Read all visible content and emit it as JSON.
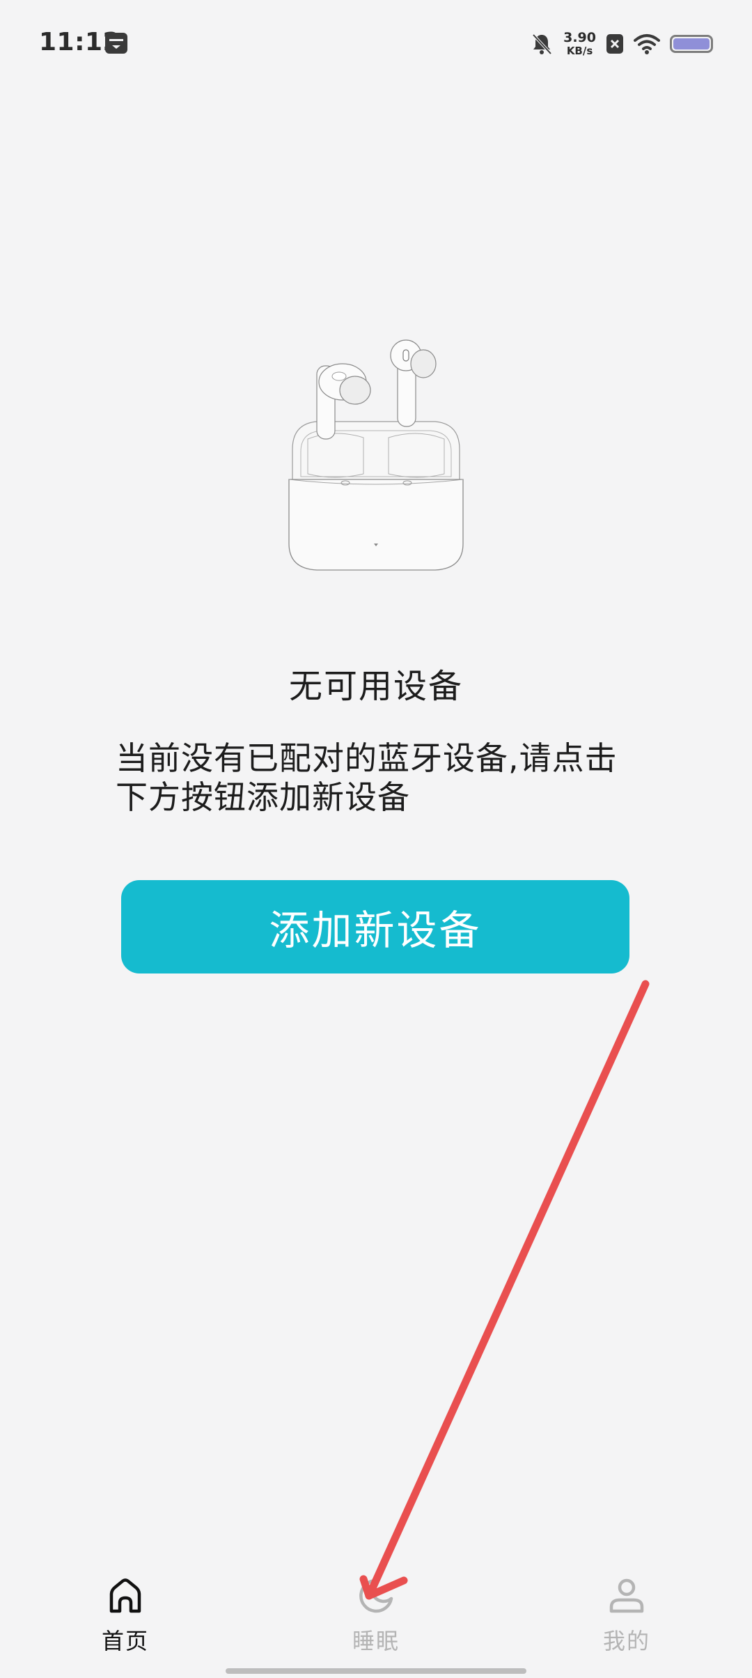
{
  "status_bar": {
    "time": "11:12",
    "network_speed_value": "3.90",
    "network_speed_unit": "KB/s",
    "battery_level": 1.0,
    "icons": [
      "calendar-icon",
      "bell-muted-icon",
      "no-sim-icon",
      "wifi-icon",
      "battery-icon"
    ]
  },
  "main": {
    "empty_title": "无可用设备",
    "empty_description": "当前没有已配对的蓝牙设备,请点击下方按钮添加新设备",
    "add_button_label": "添加新设备",
    "image_icon": "earbuds-case-illustration"
  },
  "bottom_nav": {
    "items": [
      {
        "label": "首页",
        "icon": "home-icon",
        "active": true
      },
      {
        "label": "睡眠",
        "icon": "moon-icon",
        "active": false
      },
      {
        "label": "我的",
        "icon": "person-icon",
        "active": false
      }
    ]
  },
  "colors": {
    "background": "#f4f4f5",
    "accent": "#15bbcf",
    "annotation_arrow": "#e94f4f",
    "inactive_nav": "#b4b4b4"
  }
}
